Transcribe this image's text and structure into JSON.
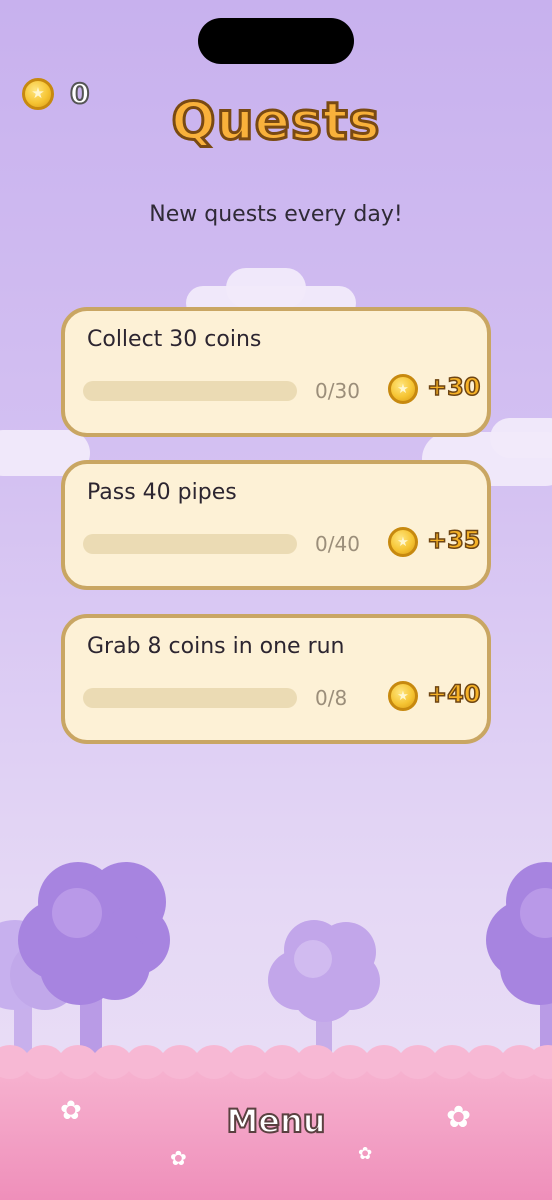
{
  "hud": {
    "coin_icon": "coin-icon",
    "coin_count": "0"
  },
  "header": {
    "title": "Quests",
    "subtitle": "New quests every day!"
  },
  "quests": [
    {
      "title": "Collect 30 coins",
      "progress": "0/30",
      "progress_fraction": 0,
      "reward": "+30"
    },
    {
      "title": "Pass 40 pipes",
      "progress": "0/40",
      "progress_fraction": 0,
      "reward": "+35"
    },
    {
      "title": "Grab 8 coins in one run",
      "progress": "0/8",
      "progress_fraction": 0,
      "reward": "+40"
    }
  ],
  "footer": {
    "menu_label": "Menu"
  },
  "colors": {
    "background_top": "#c8b1ee",
    "card_bg": "#fdf1d6",
    "card_border": "#c9a663",
    "title_fill": "#f9b13b",
    "ground": "#ef8fba",
    "tree": "#a784e0"
  }
}
